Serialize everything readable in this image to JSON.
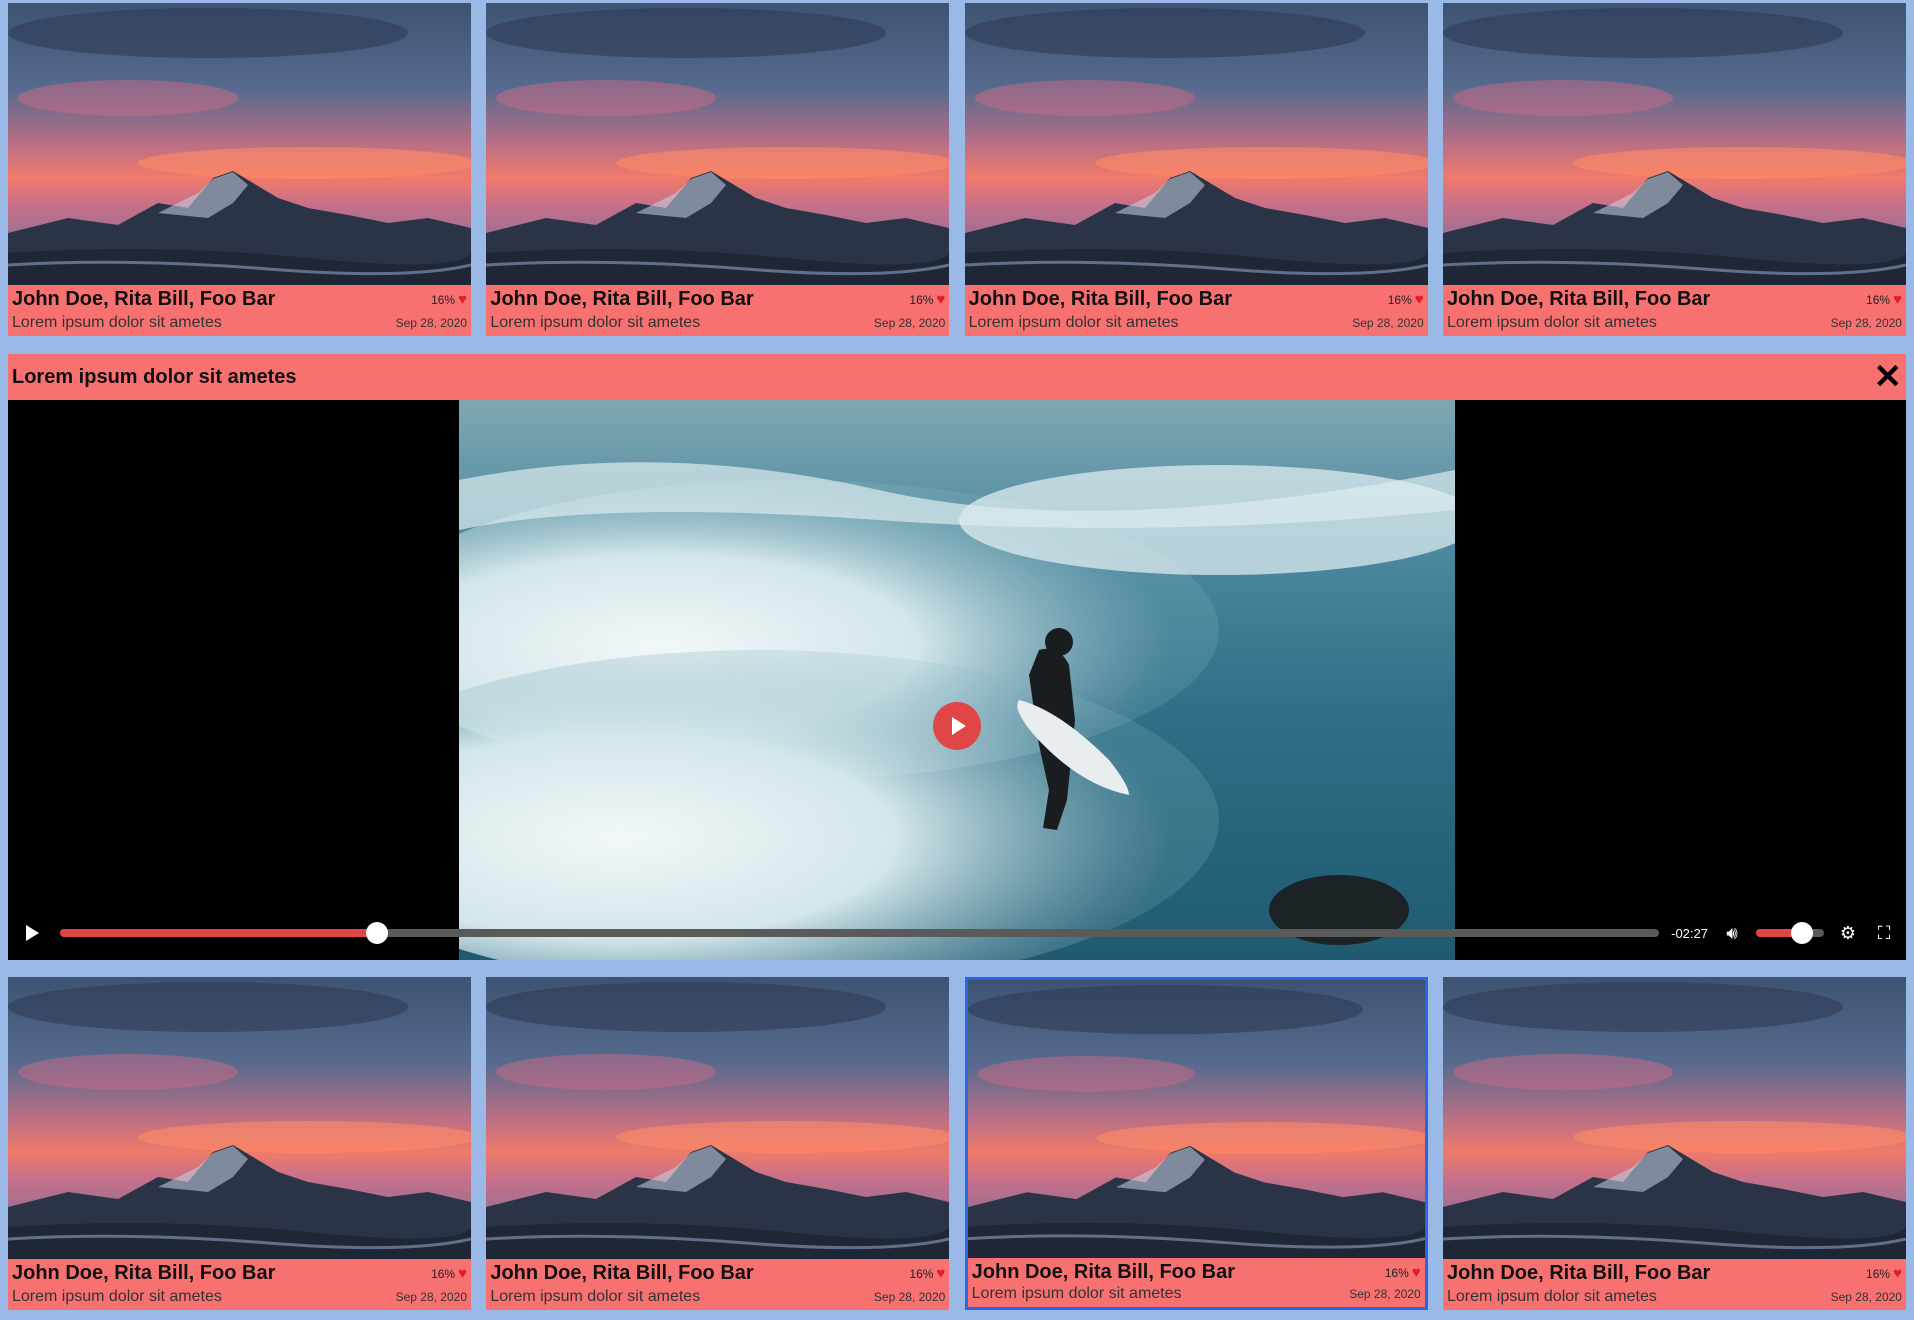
{
  "cards": [
    {
      "authors": "John Doe, Rita Bill, Foo Bar",
      "percent": "16%",
      "description": "Lorem ipsum dolor sit ametes",
      "date": "Sep 28, 2020"
    },
    {
      "authors": "John Doe, Rita Bill, Foo Bar",
      "percent": "16%",
      "description": "Lorem ipsum dolor sit ametes",
      "date": "Sep 28, 2020"
    },
    {
      "authors": "John Doe, Rita Bill, Foo Bar",
      "percent": "16%",
      "description": "Lorem ipsum dolor sit ametes",
      "date": "Sep 28, 2020"
    },
    {
      "authors": "John Doe, Rita Bill, Foo Bar",
      "percent": "16%",
      "description": "Lorem ipsum dolor sit ametes",
      "date": "Sep 28, 2020"
    },
    {
      "authors": "John Doe, Rita Bill, Foo Bar",
      "percent": "16%",
      "description": "Lorem ipsum dolor sit ametes",
      "date": "Sep 28, 2020"
    },
    {
      "authors": "John Doe, Rita Bill, Foo Bar",
      "percent": "16%",
      "description": "Lorem ipsum dolor sit ametes",
      "date": "Sep 28, 2020"
    },
    {
      "authors": "John Doe, Rita Bill, Foo Bar",
      "percent": "16%",
      "description": "Lorem ipsum dolor sit ametes",
      "date": "Sep 28, 2020",
      "selected": true
    },
    {
      "authors": "John Doe, Rita Bill, Foo Bar",
      "percent": "16%",
      "description": "Lorem ipsum dolor sit ametes",
      "date": "Sep 28, 2020"
    }
  ],
  "player": {
    "title": "Lorem ipsum dolor sit ametes",
    "time_remaining": "-02:27",
    "progress_fraction": 0.198,
    "volume_fraction": 0.68,
    "icons": {
      "close": "close-icon",
      "play": "play-icon",
      "volume": "volume-icon",
      "settings": "gear-icon",
      "fullscreen": "fullscreen-icon",
      "like": "heart-icon"
    }
  },
  "colors": {
    "background": "#9bb9e6",
    "accent": "#f87171",
    "player_accent": "#e04646",
    "selected_border": "#2b63e9"
  }
}
